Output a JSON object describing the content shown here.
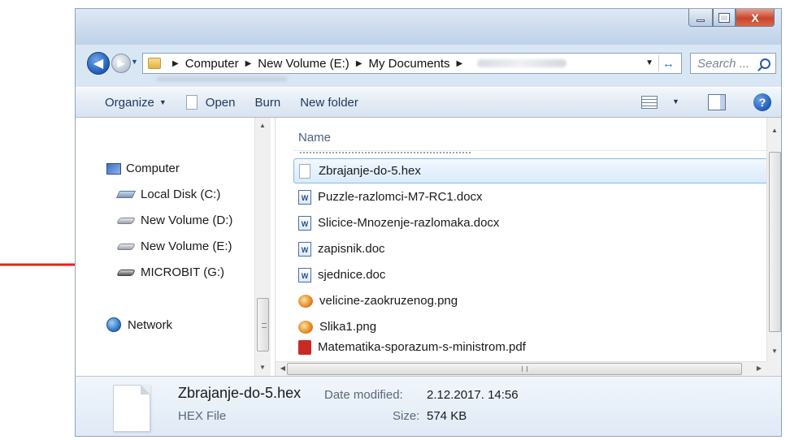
{
  "window": {
    "caption_close": "X"
  },
  "address": {
    "crumbs": [
      "Computer",
      "New Volume (E:)",
      "My Documents"
    ],
    "search_placeholder": "Search ..."
  },
  "toolbar": {
    "organize": "Organize",
    "open": "Open",
    "burn": "Burn",
    "new_folder": "New folder",
    "help": "?"
  },
  "nav": {
    "computer": "Computer",
    "drives": [
      "Local Disk (C:)",
      "New Volume (D:)",
      "New Volume (E:)",
      "MICROBIT (G:)"
    ],
    "network": "Network"
  },
  "filelist": {
    "column_name": "Name",
    "files": [
      {
        "name": "Zbrajanje-do-5.hex",
        "icon": "blank-file-icon",
        "selected": true
      },
      {
        "name": "Puzzle-razlomci-M7-RC1.docx",
        "icon": "word-doc-icon"
      },
      {
        "name": "Slicice-Mnozenje-razlomaka.docx",
        "icon": "word-doc-icon"
      },
      {
        "name": "zapisnik.doc",
        "icon": "word-doc-icon"
      },
      {
        "name": "sjednice.doc",
        "icon": "word-doc-icon"
      },
      {
        "name": "velicine-zaokruzenog.png",
        "icon": "png-image-icon"
      },
      {
        "name": "Slika1.png",
        "icon": "png-image-icon"
      },
      {
        "name": "Matematika-sporazum-s-ministrom.pdf",
        "icon": "pdf-file-icon"
      }
    ]
  },
  "details": {
    "name": "Zbrajanje-do-5.hex",
    "type": "HEX File",
    "modified_label": "Date modified:",
    "modified_value": "2.12.2017. 14:56",
    "size_label": "Size:",
    "size_value": "574 KB"
  },
  "colors": {
    "annotation_arrow": "#e8211b",
    "selection_border": "#86b9ea"
  }
}
